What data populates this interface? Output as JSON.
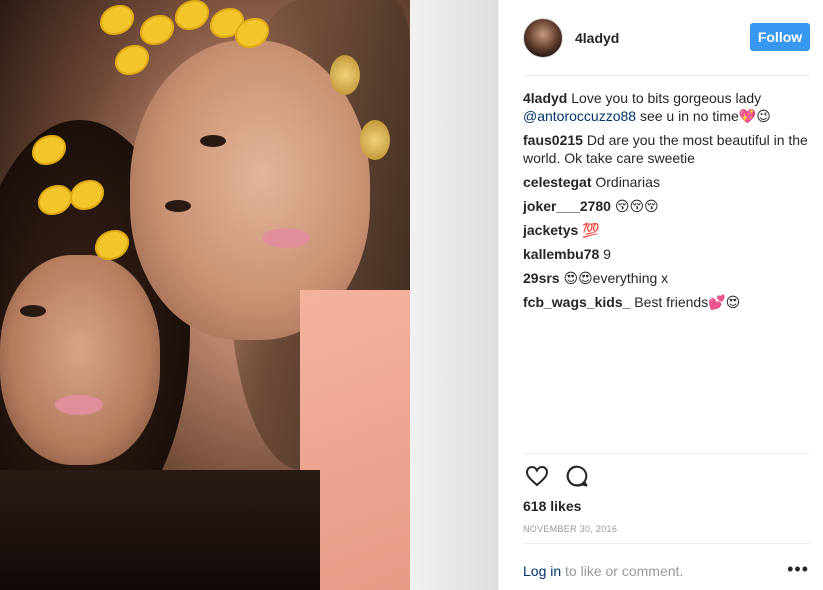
{
  "post": {
    "username": "4ladyd",
    "follow_label": "Follow"
  },
  "comments": [
    {
      "user": "4ladyd",
      "text_before": "Love you to bits gorgeous lady",
      "mention": "@antoroccuzzo88",
      "text_after": "see u in no time💖😉"
    },
    {
      "user": "faus0215",
      "text": "Dd are you the most beautiful in the world. Ok take care sweetie"
    },
    {
      "user": "celestegat",
      "text": "Ordinarias"
    },
    {
      "user": "joker___2780",
      "text": "😚😚😚"
    },
    {
      "user": "jacketys",
      "text": "💯"
    },
    {
      "user": "kallembu78",
      "text": "9"
    },
    {
      "user": "29srs",
      "text": "😍😍everything x"
    },
    {
      "user": "fcb_wags_kids_",
      "text": "Best friends💕😍"
    }
  ],
  "actions": {
    "like_icon": "heart-icon",
    "comment_icon": "speech-bubble-icon"
  },
  "likes": "618 likes",
  "date": "NOVEMBER 30, 2016",
  "footer": {
    "login_label": "Log in",
    "rest": " to like or comment.",
    "more_icon": "ellipsis-icon"
  },
  "colors": {
    "follow_button": "#3897f0",
    "mention": "#003569",
    "muted": "#999999"
  }
}
